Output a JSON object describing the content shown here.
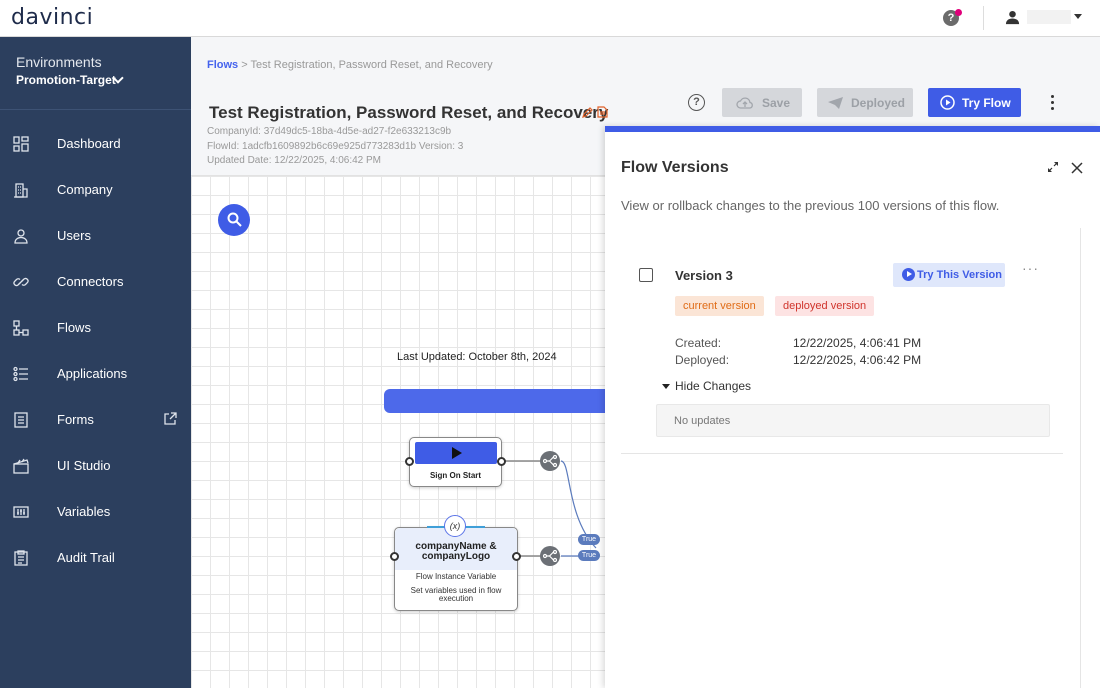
{
  "app": {
    "logo": "davinci"
  },
  "header": {
    "help_icon": "help-circle-icon",
    "user_icon": "person-icon"
  },
  "sidebar": {
    "environment_label": "Environments",
    "environment_value": "Promotion-Target",
    "items": [
      {
        "label": "Dashboard",
        "icon": "dashboard-icon"
      },
      {
        "label": "Company",
        "icon": "building-icon"
      },
      {
        "label": "Users",
        "icon": "user-icon"
      },
      {
        "label": "Connectors",
        "icon": "link-icon"
      },
      {
        "label": "Flows",
        "icon": "flow-icon"
      },
      {
        "label": "Applications",
        "icon": "applications-icon"
      },
      {
        "label": "Forms",
        "icon": "form-icon"
      },
      {
        "label": "UI Studio",
        "icon": "clapperboard-icon"
      },
      {
        "label": "Variables",
        "icon": "variables-icon"
      },
      {
        "label": "Audit Trail",
        "icon": "clipboard-icon"
      }
    ]
  },
  "breadcrumb": {
    "link": "Flows",
    "separator": ">",
    "current": "Test Registration, Password Reset, and Recovery"
  },
  "flow": {
    "title": "Test Registration, Password Reset, and Recovery",
    "company_id": "CompanyId: 37d49dc5-18ba-4d5e-ad27-f2e633213c9b",
    "flow_id": "FlowId: 1adcfb1609892b6c69e925d773283d1b Version: 3",
    "updated": "Updated Date: 12/22/2025, 4:06:42 PM"
  },
  "toolbar": {
    "save_label": "Save",
    "deployed_label": "Deployed",
    "try_label": "Try Flow"
  },
  "canvas": {
    "last_updated": "Last Updated: October 8th, 2024",
    "start_node_label": "Sign On Start",
    "var_node_title": "companyName & companyLogo",
    "var_node_type": "Flow Instance Variable",
    "var_node_desc": "Set variables used in flow execution",
    "var_badge": "(x)",
    "true_label_1": "True",
    "true_label_2": "True"
  },
  "panel": {
    "title": "Flow Versions",
    "description": "View or rollback changes to the previous 100 versions of this flow.",
    "version": {
      "name": "Version 3",
      "try_label": "Try This Version",
      "more": "···",
      "tag_current": "current version",
      "tag_deployed": "deployed version",
      "created_label": "Created:",
      "created_value": "12/22/2025, 4:06:41 PM",
      "deployed_label": "Deployed:",
      "deployed_value": "12/22/2025, 4:06:42 PM",
      "hide_changes": "Hide Changes",
      "no_updates": "No updates"
    }
  },
  "colors": {
    "accent": "#3f5ce6",
    "sidebar": "#2c3f5e",
    "tag_current": "#e06c17",
    "tag_deployed": "#d0342c"
  }
}
